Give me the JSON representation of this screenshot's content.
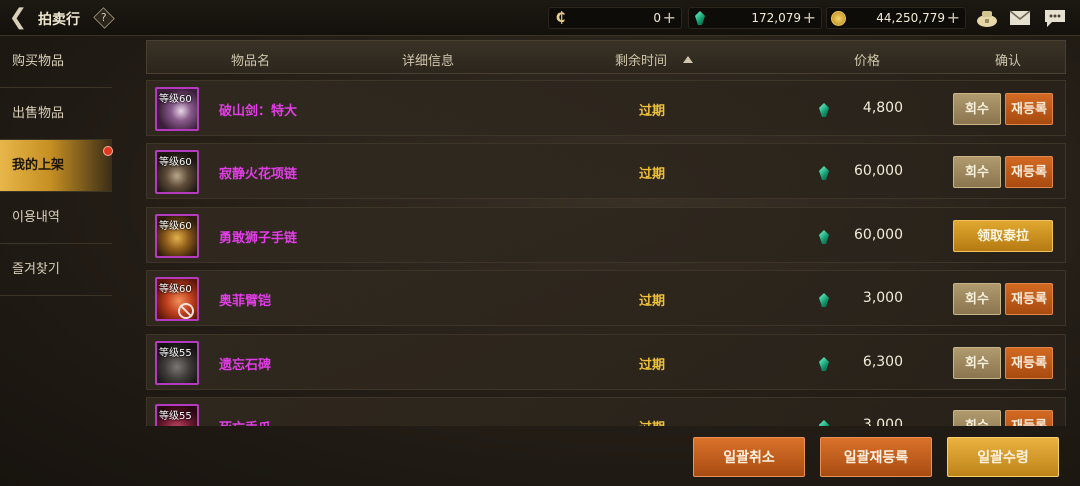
{
  "header": {
    "title": "拍卖行",
    "help_label": "?",
    "currencies": [
      {
        "name": "c-coin",
        "value": "0"
      },
      {
        "name": "tera",
        "value": "172,079"
      },
      {
        "name": "gold",
        "value": "44,250,779"
      }
    ],
    "plus_label": "+"
  },
  "sidebar": {
    "items": [
      {
        "label": "购买物品"
      },
      {
        "label": "出售物品"
      },
      {
        "label": "我的上架"
      },
      {
        "label": "이용내역"
      },
      {
        "label": "즐겨찾기"
      }
    ],
    "active_index": 2
  },
  "table": {
    "headers": {
      "name": "物品名",
      "detail": "详细信息",
      "time": "剩余时间",
      "price": "价格",
      "confirm": "确认"
    },
    "rows": [
      {
        "level": "等级60",
        "name": "破山剑：特大",
        "status": "过期",
        "price": "4,800",
        "actions": [
          "회수",
          "재등록"
        ]
      },
      {
        "level": "等级60",
        "name": "寂静火花项链",
        "status": "过期",
        "price": "60,000",
        "actions": [
          "회수",
          "재등록"
        ]
      },
      {
        "level": "等级60",
        "name": "勇敢狮子手链",
        "status": "",
        "price": "60,000",
        "actions": [
          "领取泰拉"
        ]
      },
      {
        "level": "等级60",
        "name": "奥菲臂铠",
        "status": "过期",
        "price": "3,000",
        "actions": [
          "회수",
          "재등록"
        ]
      },
      {
        "level": "等级55",
        "name": "遗忘石碑",
        "status": "过期",
        "price": "6,300",
        "actions": [
          "회수",
          "재등록"
        ]
      },
      {
        "level": "等级55",
        "name": "死亡手爪",
        "status": "过期",
        "price": "3,000",
        "actions": [
          "회수",
          "재등록"
        ]
      }
    ]
  },
  "footer": {
    "cancel_all": "일괄취소",
    "relist_all": "일괄재등록",
    "claim_all": "일괄수령"
  },
  "colors": {
    "item_name": "#e13de6",
    "status": "#f0c23a",
    "accent_gold": "#e7b64a",
    "accent_orange": "#d36a22"
  }
}
